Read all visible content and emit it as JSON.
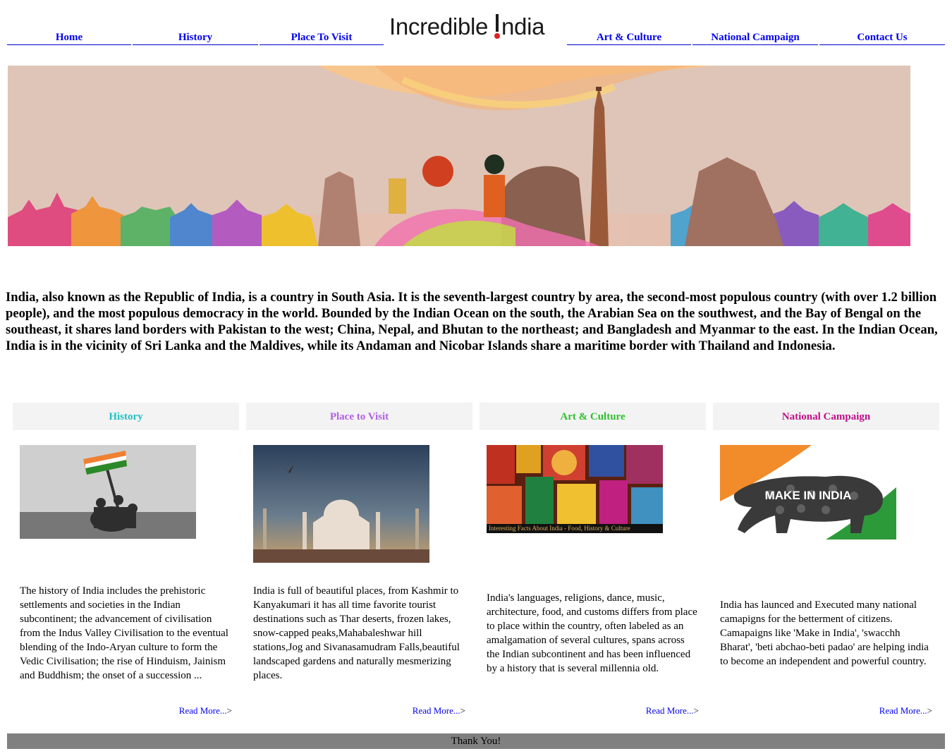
{
  "nav": {
    "items": [
      {
        "label": "Home"
      },
      {
        "label": "History"
      },
      {
        "label": "Place To Visit"
      },
      {
        "label": "Art & Culture"
      },
      {
        "label": "National Campaign"
      },
      {
        "label": "Contact Us"
      }
    ],
    "logo_text_before": "Incredible ",
    "logo_text_after": "ndia",
    "logo_mark": "!"
  },
  "intro": {
    "text": "India, also known as the Republic of India, is a country in South Asia. It is the seventh-largest country by area, the second-most populous country (with over 1.2 billion people), and the most populous democracy in the world. Bounded by the Indian Ocean on the south, the Arabian Sea on the southwest, and the Bay of Bengal on the southeast, it shares land borders with Pakistan to the west; China, Nepal, and Bhutan to the northeast; and Bangladesh and Myanmar to the east. In the Indian Ocean, India is in the vicinity of Sri Lanka and the Maldives, while its Andaman and Nicobar Islands share a maritime border with Thailand and Indonesia."
  },
  "cards": [
    {
      "title": "History",
      "title_color": "#20c0c0",
      "text": "The history of India includes the prehistoric settlements and societies in the Indian subcontinent; the advancement of civilisation from the Indus Valley Civilisation to the eventual blending of the Indo-Aryan culture to form the Vedic Civilisation; the rise of Hinduism, Jainism and Buddhism; the onset of a succession ...",
      "read_more": "Read More...",
      "arrow": ">"
    },
    {
      "title": "Place to Visit",
      "title_color": "#b060e0",
      "text": "India is full of beautiful places, from Kashmir to Kanyakumari it has all time favorite tourist destinations such as Thar deserts, frozen lakes, snow-capped peaks,Mahabaleshwar hill stations,Jog and Sivanasamudram Falls,beautiful landscaped gardens and naturally mesmerizing places.",
      "read_more": "Read More...",
      "arrow": ">"
    },
    {
      "title": "Art & Culture",
      "title_color": "#30c030",
      "text": "India's languages, religions, dance, music, architecture, food, and customs differs from place to place within the country, often labeled as an amalgamation of several cultures, spans across the Indian subcontinent and has been influenced by a history that is several millennia old.",
      "image_caption": "Interesting Facts About India - Food, History & Culture",
      "read_more": "Read More...",
      "arrow": ">"
    },
    {
      "title": "National Campaign",
      "title_color": "#c0108a",
      "text": "India has launced and Executed many national camapigns for the betterment of citizens. Camapaigns like 'Make in India', 'swacchh Bharat', 'beti abchao-beti padao' are helping india to become an independent and powerful country.",
      "image_caption": "MAKE IN INDIA",
      "read_more": "Read More...",
      "arrow": ">"
    }
  ],
  "footer": {
    "text": "Thank You!"
  }
}
